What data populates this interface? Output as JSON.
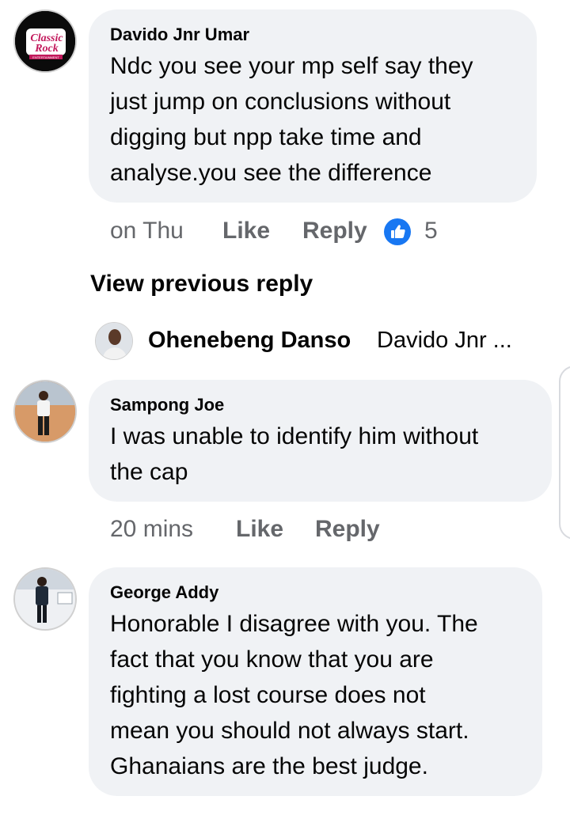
{
  "comments": [
    {
      "author": "Davido Jnr Umar",
      "avatar_icon": "classic-rock-logo-avatar",
      "avatar_logo_text": [
        "Classic",
        "Rock",
        "ENTERTAINMENT"
      ],
      "lines": [
        "Ndc you see your mp self say they",
        "just jump on conclusions without",
        "digging but npp take time and",
        "analyse.you see the difference"
      ],
      "time": "on Thu",
      "like_label": "Like",
      "reply_label": "Reply",
      "reaction_icon": "thumbs-up-reaction-icon",
      "reaction_count": "5"
    },
    {
      "author": "Sampong Joe",
      "avatar_icon": "person-photo-avatar",
      "lines": [
        "I was unable to identify him without",
        "the cap"
      ],
      "time": "20 mins",
      "like_label": "Like",
      "reply_label": "Reply"
    },
    {
      "author": "George Addy",
      "avatar_icon": "person-photo-avatar",
      "lines": [
        "Honorable I disagree with you. The",
        "fact that you know that you are",
        "fighting a lost course does not",
        "mean you should not always start.",
        "Ghanaians are the best judge."
      ]
    }
  ],
  "view_previous_reply": "View previous reply",
  "collapsed_reply": {
    "author": "Ohenebeng Danso",
    "preview": "Davido Jnr ..."
  },
  "colors": {
    "bubble_bg": "#f0f2f5",
    "meta_text": "#65676b",
    "like_blue": "#1877f2",
    "text": "#050505"
  }
}
